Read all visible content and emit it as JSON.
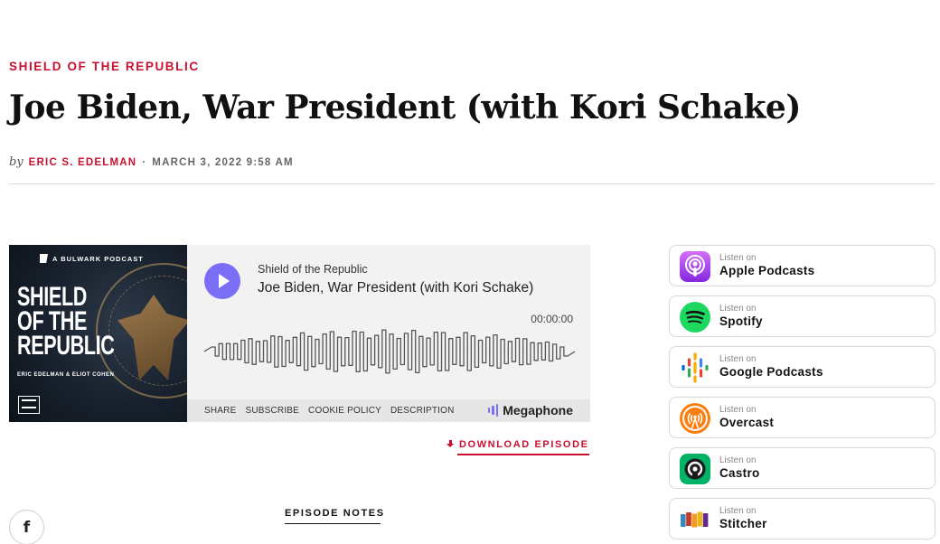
{
  "article": {
    "kicker": "SHIELD OF THE REPUBLIC",
    "title": "Joe Biden, War President (with Kori Schake)",
    "by": "by",
    "author": "ERIC S. EDELMAN",
    "separator": "·",
    "date": "MARCH 3, 2022 9:58 AM"
  },
  "player": {
    "artwork": {
      "brand": "A BULWARK PODCAST",
      "show_line1": "SHIELD",
      "show_line2": "OF THE",
      "show_line3": "REPUBLIC",
      "hosts": "ERIC EDELMAN & ELIOT COHEN"
    },
    "show_name": "Shield of the Republic",
    "episode_title": "Joe Biden, War President (with Kori Schake)",
    "time": "00:00:00",
    "bar_links": [
      "SHARE",
      "SUBSCRIBE",
      "COOKIE POLICY",
      "DESCRIPTION"
    ],
    "provider": "Megaphone",
    "accent": "#7b6ef6"
  },
  "download_label": "DOWNLOAD EPISODE",
  "episode_notes_label": "EPISODE NOTES",
  "social": {
    "facebook_glyph": "f"
  },
  "listen": {
    "prefix": "Listen on",
    "services": [
      {
        "name": "Apple Podcasts",
        "icon": "apple-podcasts-icon"
      },
      {
        "name": "Spotify",
        "icon": "spotify-icon"
      },
      {
        "name": "Google Podcasts",
        "icon": "google-podcasts-icon"
      },
      {
        "name": "Overcast",
        "icon": "overcast-icon"
      },
      {
        "name": "Castro",
        "icon": "castro-icon"
      },
      {
        "name": "Stitcher",
        "icon": "stitcher-icon"
      }
    ]
  },
  "colors": {
    "brand_red": "#c8102e"
  }
}
